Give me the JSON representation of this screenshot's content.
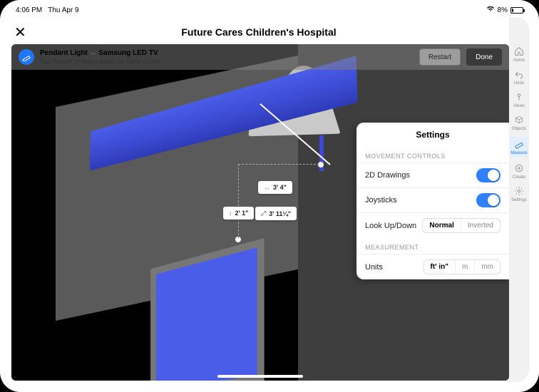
{
  "status": {
    "time": "4:06 PM",
    "date": "Thu Apr 9",
    "battery_pct": "8%"
  },
  "title": "Future Cares Children's Hospital",
  "overlay": {
    "object_a": "Pendant Light",
    "sep": "↔",
    "object_b": "Samsung LED TV",
    "hint": "Tap Restart to begin again, or Done to exit.",
    "restart": "Restart",
    "done": "Done"
  },
  "measurements": {
    "horiz": "3' 4\"",
    "vert": "2' 1\"",
    "diag": "3' 11¼\""
  },
  "rail": {
    "home": "Home",
    "undo": "Undo",
    "views": "Views",
    "objects": "Objects",
    "measure": "Measure",
    "create": "Create",
    "settings": "Settings"
  },
  "settings": {
    "title": "Settings",
    "sect_movement": "MOVEMENT CONTROLS",
    "row_2d": "2D Drawings",
    "row_joysticks": "Joysticks",
    "row_look": "Look Up/Down",
    "look_opts": {
      "normal": "Normal",
      "inverted": "Inverted"
    },
    "sect_measure": "MEASUREMENT",
    "row_units": "Units",
    "unit_opts": {
      "ftin": "ft' in\"",
      "m": "m",
      "mm": "mm"
    }
  }
}
